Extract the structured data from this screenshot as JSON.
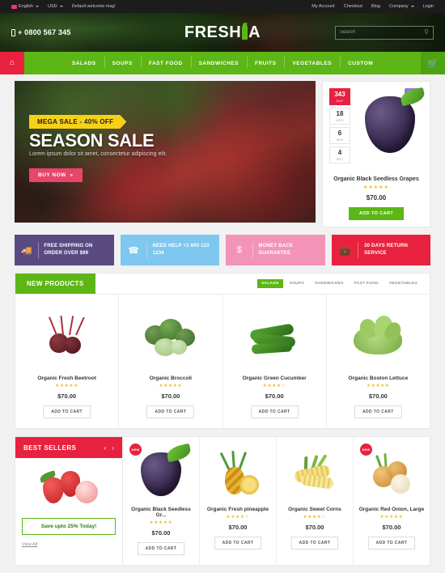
{
  "topbar": {
    "language": "English",
    "currency": "USD",
    "welcome": "Default welcome msg!",
    "links": [
      "My Account",
      "Checkout",
      "Blog",
      "Company",
      "Login"
    ]
  },
  "header": {
    "phone": "+ 0800 567 345",
    "logo_part1": "FRESH",
    "logo_part2": "A",
    "search_placeholder": "Search",
    "search_value": ""
  },
  "nav": {
    "home_icon": "home-icon",
    "cart_icon": "basket-icon",
    "items": [
      "SALADS",
      "SOUPS",
      "FAST FOOD",
      "SANDWICHES",
      "FRUITS",
      "VEGETABLES",
      "CUSTOM"
    ]
  },
  "hero": {
    "ribbon": "MEGA SALE - 40% OFF",
    "title": "SEASON SALE",
    "subtitle": "Lorem ipsum dolor sit amet, consectetur adipiscing elit.",
    "button": "BUY NOW"
  },
  "deal": {
    "badge": "HOT",
    "countdown": [
      {
        "value": "343",
        "unit": "DAY"
      },
      {
        "value": "18",
        "unit": "HRS"
      },
      {
        "value": "6",
        "unit": "MIN"
      },
      {
        "value": "4",
        "unit": "SEC"
      }
    ],
    "name": "Organic Black Seedless Grapes",
    "stars": "★★★★★",
    "price": "$70.00",
    "button": "ADD TO CART"
  },
  "features": [
    {
      "icon": "truck-icon",
      "text": "FREE SHIPPING ON ORDER OVER $99",
      "color": "#5a4a82"
    },
    {
      "icon": "phone-icon",
      "text": "NEED HELP +1 800 123 1234",
      "color": "#7ec7ef"
    },
    {
      "icon": "dollar-icon",
      "text": "MONEY BACK GUARANTEE",
      "color": "#f493b8"
    },
    {
      "icon": "briefcase-icon",
      "text": "30 DAYS RETURN SERVICE",
      "color": "#e8213f"
    }
  ],
  "new_products": {
    "title": "NEW PRODUCTS",
    "tabs": [
      "SALADS",
      "SOUPS",
      "SANDWICHES",
      "FAST FOOD",
      "VEGETABLES"
    ],
    "active_tab": "SALADS",
    "items": [
      {
        "name": "Organic Fresh Beetroot",
        "stars": "★★★★★",
        "price": "$70.00",
        "button": "ADD TO CART"
      },
      {
        "name": "Organic Broccoli",
        "stars": "★★★★★",
        "price": "$70.00",
        "button": "ADD TO CART"
      },
      {
        "name": "Organic Green Cucumber",
        "stars": "★★★★☆",
        "price": "$70.00",
        "button": "ADD TO CART"
      },
      {
        "name": "Organic Boston Lettuce",
        "stars": "★★★★★",
        "price": "$70.00",
        "button": "ADD TO CART"
      }
    ]
  },
  "best_sellers": {
    "title": "BEST SELLERS",
    "prev": "‹",
    "next": "›",
    "promo_button": "Save upto 25% Today!",
    "view_all": "View All",
    "items": [
      {
        "name": "Organic Black Seedless Gr...",
        "stars": "★★★★★",
        "price": "$70.00",
        "button": "ADD TO CART",
        "badge": "NEW"
      },
      {
        "name": "Organic Fresh pineapple",
        "stars": "★★★★☆",
        "price": "$70.00",
        "button": "ADD TO CART",
        "badge": ""
      },
      {
        "name": "Organic Sweet Corns",
        "stars": "★★★★☆",
        "price": "$70.00",
        "button": "ADD TO CART",
        "badge": ""
      },
      {
        "name": "Organic Red Onion, Large",
        "stars": "★★★★★",
        "price": "$70.00",
        "button": "ADD TO CART",
        "badge": "NEW"
      }
    ]
  },
  "colors": {
    "green": "#5cb615",
    "red": "#e8213f",
    "yellow": "#f7d117",
    "pink": "#e8456a",
    "purple": "#8f7ae0"
  }
}
